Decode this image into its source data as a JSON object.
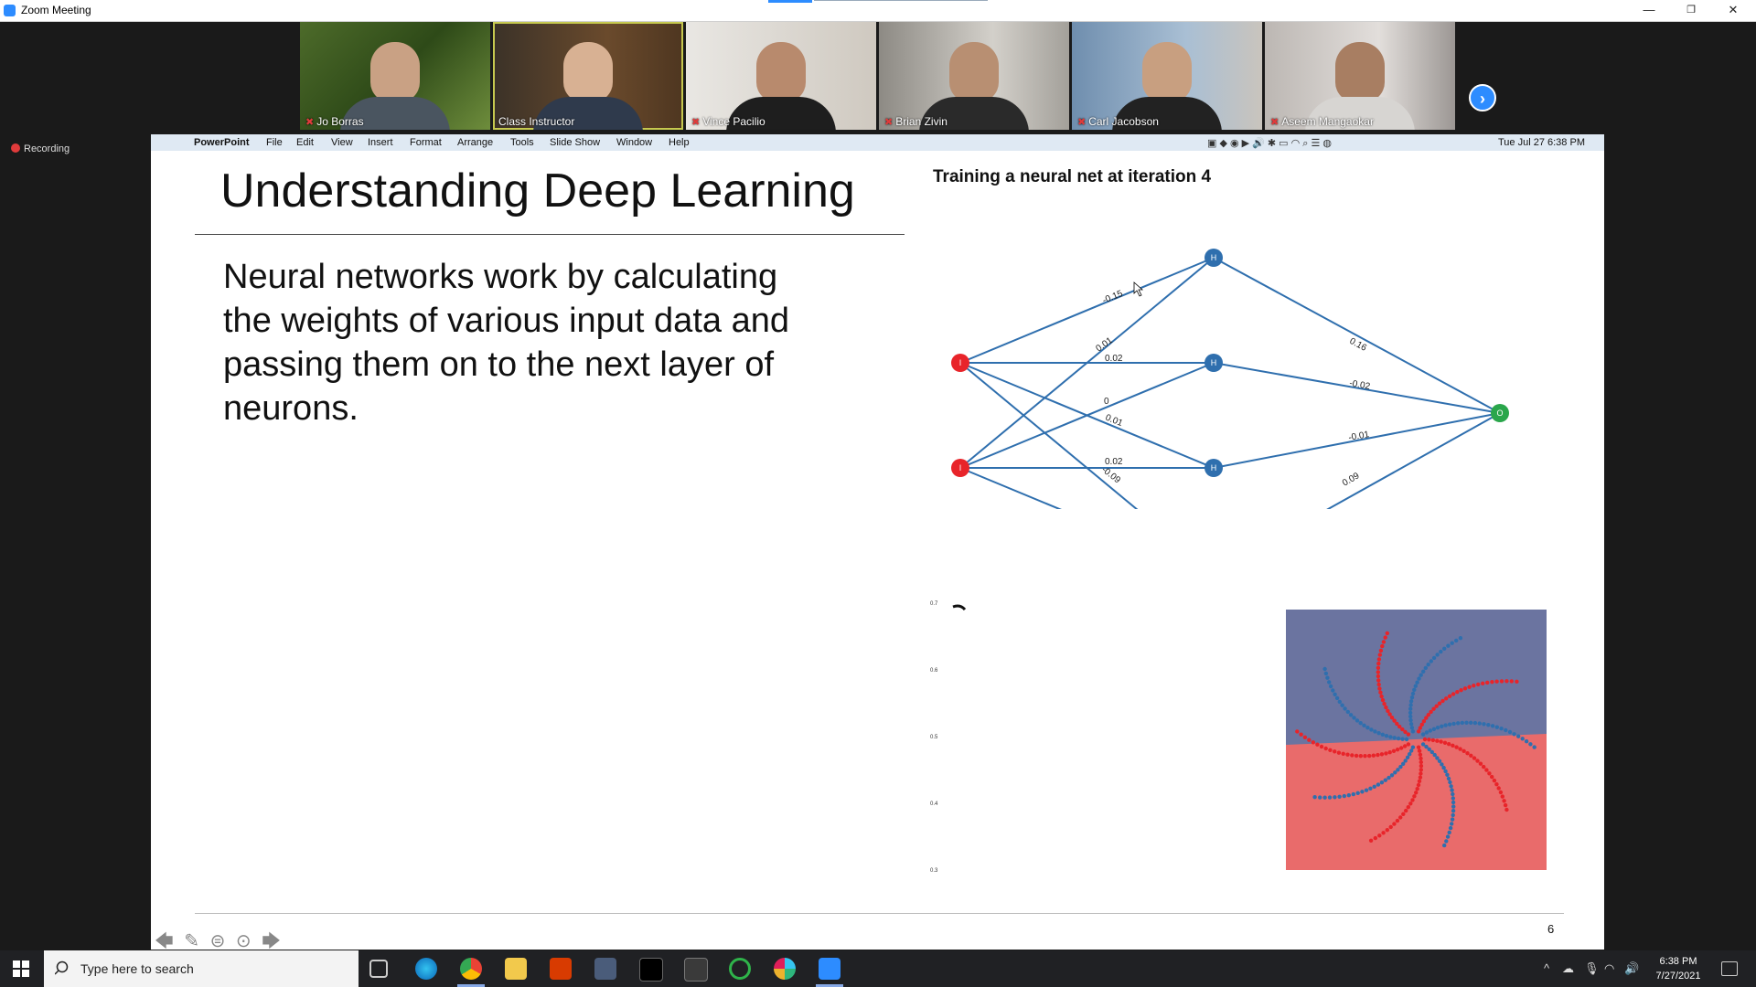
{
  "window": {
    "title": "Zoom Meeting",
    "minimize": "—",
    "restore": "❐",
    "close": "✕"
  },
  "participants": [
    {
      "name": "Jo Borras"
    },
    {
      "name": "Class Instructor"
    },
    {
      "name": "Vince Pacilio"
    },
    {
      "name": "Brian Zivin"
    },
    {
      "name": "Carl Jacobson"
    },
    {
      "name": "Aseem Mangaokar"
    }
  ],
  "recording_label": "Recording",
  "mac_menubar": {
    "app": "PowerPoint",
    "items": [
      "File",
      "Edit",
      "View",
      "Insert",
      "Format",
      "Arrange",
      "Tools",
      "Slide Show",
      "Window",
      "Help"
    ],
    "clock": "Tue Jul 27  6:38 PM"
  },
  "slide": {
    "title": "Understanding Deep Learning",
    "body": "Neural networks work by calculating the weights of various input data and passing them on to the next layer of neurons.",
    "nn_title": "Training a neural net at iteration 4",
    "input_label": "I",
    "hidden_label": "H",
    "output_label": "O",
    "weights_input": [
      "-0.15",
      "0.01",
      "0.02",
      "0",
      "0.01",
      "0.02",
      "-0.09",
      "0"
    ],
    "weights_output": [
      "0.16",
      "-0.02",
      "-0.01",
      "0.09"
    ],
    "y_ticks": [
      "0.7",
      "0.6",
      "0.5",
      "0.4",
      "0.3"
    ],
    "page_number": "6"
  },
  "colors": {
    "input_node": "#e8242a",
    "hidden_node": "#2f6fae",
    "output_node": "#2aa64b",
    "plot_top": "#6b74a0",
    "plot_bottom": "#e96b6b"
  },
  "taskbar": {
    "search_placeholder": "Type here to search",
    "time": "6:38 PM",
    "date": "7/27/2021"
  }
}
